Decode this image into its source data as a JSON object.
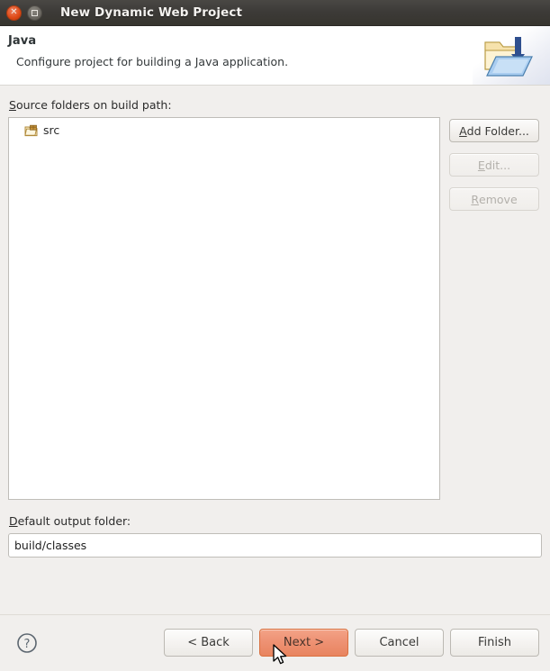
{
  "window": {
    "title": "New Dynamic Web Project",
    "close_label": "close-window",
    "maximize_label": "maximize-window"
  },
  "header": {
    "title": "Java",
    "description": "Configure project for building a Java application.",
    "banner_icon": "folder-import-icon"
  },
  "main": {
    "source_folders_label_mnemonic": "S",
    "source_folders_label_rest": "ource folders on build path:",
    "source_folders": [
      {
        "icon": "java-source-folder-icon",
        "name": "src"
      }
    ],
    "side_buttons": [
      {
        "mnemonic": "A",
        "pre": "",
        "rest": "dd Folder...",
        "enabled": true,
        "name": "add-folder-button"
      },
      {
        "mnemonic": "E",
        "pre": "",
        "rest": "dit...",
        "enabled": false,
        "name": "edit-button"
      },
      {
        "mnemonic": "R",
        "pre": "",
        "rest": "emove",
        "enabled": false,
        "name": "remove-button"
      }
    ],
    "output_label_mnemonic": "D",
    "output_label_rest": "efault output folder:",
    "output_folder_value": "build/classes",
    "output_folder_placeholder": "build/classes"
  },
  "footer": {
    "help_icon": "help-question-icon",
    "buttons": [
      {
        "label": "< Back",
        "name": "back-button",
        "primary": false
      },
      {
        "label": "Next >",
        "name": "next-button",
        "primary": true
      },
      {
        "label": "Cancel",
        "name": "cancel-button",
        "primary": false
      },
      {
        "label": "Finish",
        "name": "finish-button",
        "primary": false
      }
    ]
  },
  "colors": {
    "titlebar_bg": "#3c3a37",
    "dialog_bg": "#f1efed",
    "primary_button": "#ee9274",
    "close_button": "#dd4814",
    "field_border": "#bfbdb8"
  }
}
